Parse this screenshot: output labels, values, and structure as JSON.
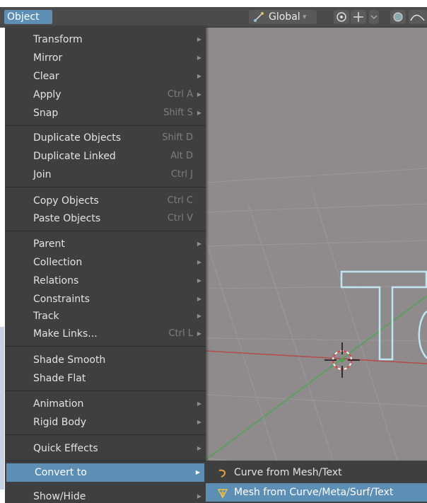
{
  "header": {
    "object_menu": "Object",
    "orientation": "Global"
  },
  "menu": {
    "groups": [
      [
        {
          "label": "Transform",
          "shortcut": "",
          "submenu": true
        },
        {
          "label": "Mirror",
          "shortcut": "",
          "submenu": true
        },
        {
          "label": "Clear",
          "shortcut": "",
          "submenu": true
        },
        {
          "label": "Apply",
          "shortcut": "Ctrl A",
          "submenu": true
        },
        {
          "label": "Snap",
          "shortcut": "Shift S",
          "submenu": true
        }
      ],
      [
        {
          "label": "Duplicate Objects",
          "shortcut": "Shift D",
          "submenu": false
        },
        {
          "label": "Duplicate Linked",
          "shortcut": "Alt D",
          "submenu": false
        },
        {
          "label": "Join",
          "shortcut": "Ctrl J",
          "submenu": false
        }
      ],
      [
        {
          "label": "Copy Objects",
          "shortcut": "Ctrl C",
          "submenu": false
        },
        {
          "label": "Paste Objects",
          "shortcut": "Ctrl V",
          "submenu": false
        }
      ],
      [
        {
          "label": "Parent",
          "shortcut": "",
          "submenu": true
        },
        {
          "label": "Collection",
          "shortcut": "",
          "submenu": true
        },
        {
          "label": "Relations",
          "shortcut": "",
          "submenu": true
        },
        {
          "label": "Constraints",
          "shortcut": "",
          "submenu": true
        },
        {
          "label": "Track",
          "shortcut": "",
          "submenu": true
        },
        {
          "label": "Make Links...",
          "shortcut": "Ctrl L",
          "submenu": true
        }
      ],
      [
        {
          "label": "Shade Smooth",
          "shortcut": "",
          "submenu": false
        },
        {
          "label": "Shade Flat",
          "shortcut": "",
          "submenu": false
        }
      ],
      [
        {
          "label": "Animation",
          "shortcut": "",
          "submenu": true
        },
        {
          "label": "Rigid Body",
          "shortcut": "",
          "submenu": true
        }
      ],
      [
        {
          "label": "Quick Effects",
          "shortcut": "",
          "submenu": true
        }
      ],
      [
        {
          "label": "Convert to",
          "shortcut": "",
          "submenu": true,
          "active": true
        },
        {
          "label": "Show/Hide",
          "shortcut": "",
          "submenu": true
        }
      ]
    ]
  },
  "submenu": {
    "items": [
      {
        "label": "Curve from Mesh/Text",
        "icon": "curve-icon",
        "active": false
      },
      {
        "label": "Mesh from Curve/Meta/Surf/Text",
        "icon": "mesh-icon",
        "active": true
      }
    ]
  },
  "colors": {
    "accent": "#5d8fb5",
    "menu_bg": "#3f3f3f",
    "viewport_bg": "#8f8b8d"
  }
}
